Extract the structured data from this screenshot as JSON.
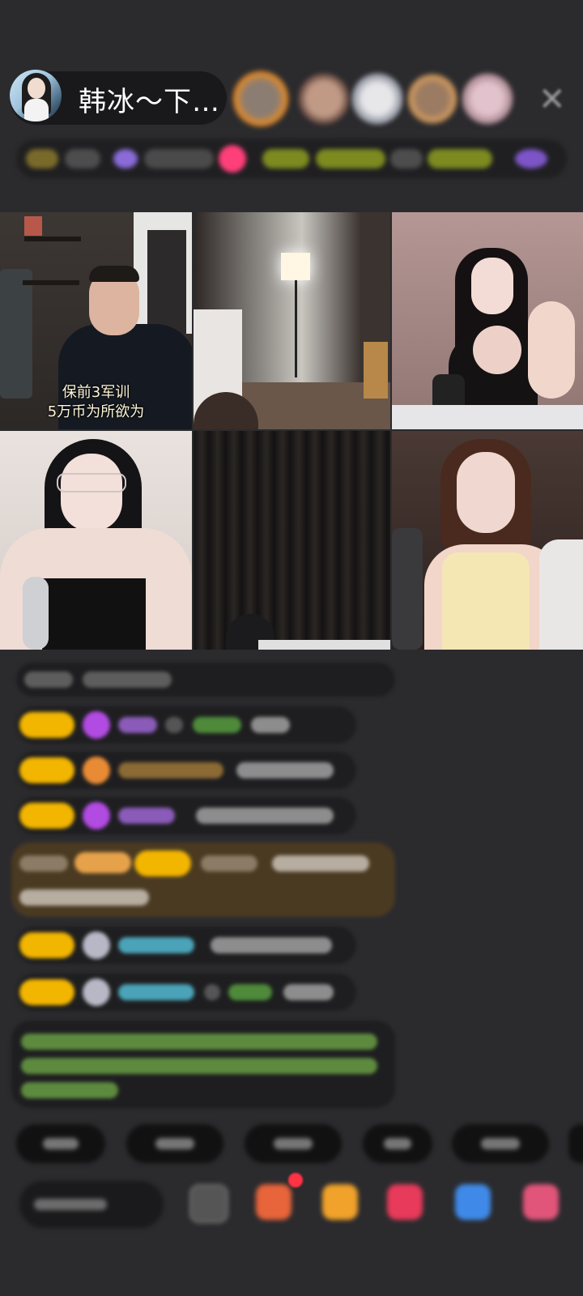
{
  "header": {
    "host_name": "韩冰～下…",
    "close_icon": "close-icon"
  },
  "video_grid": {
    "captions": [
      "保前3军训",
      "5万币为所欲为"
    ]
  },
  "colors": {
    "background": "#2b2b2e",
    "badge_yellow": "#f2b500",
    "chat_bubble": "#1e1e20",
    "highlight_bubble": "#4a3a22"
  }
}
